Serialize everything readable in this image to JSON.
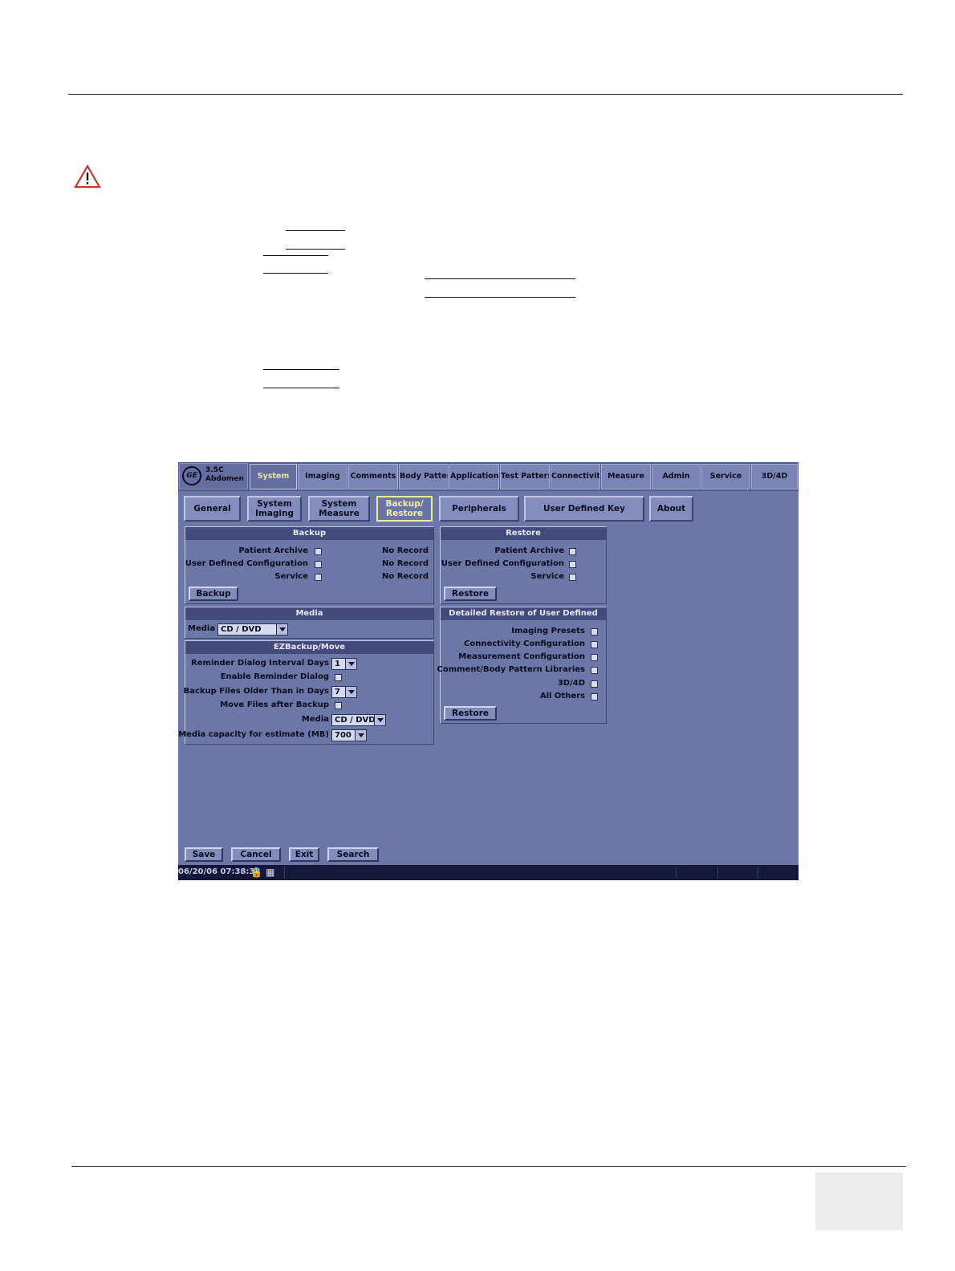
{
  "app": {
    "probe": "3.5C",
    "preset": "Abdomen",
    "logo_text": "GE"
  },
  "top_tabs": [
    {
      "label": "System"
    },
    {
      "label": "Imaging"
    },
    {
      "label": "Comments"
    },
    {
      "label": "Body Pattern"
    },
    {
      "label": "Application"
    },
    {
      "label": "Test Patterns"
    },
    {
      "label": "Connectivity"
    },
    {
      "label": "Measure"
    },
    {
      "label": "Admin"
    },
    {
      "label": "Service"
    },
    {
      "label": "3D/4D"
    }
  ],
  "sub_tabs": [
    {
      "label": "General"
    },
    {
      "label": "System\nImaging"
    },
    {
      "label": "System\nMeasure"
    },
    {
      "label": "Backup/\nRestore"
    },
    {
      "label": "Peripherals"
    },
    {
      "label": "User Defined Key"
    },
    {
      "label": "About"
    }
  ],
  "backup": {
    "title": "Backup",
    "rows": [
      {
        "label": "Patient Archive",
        "status": "No Record"
      },
      {
        "label": "User Defined Configuration",
        "status": "No Record"
      },
      {
        "label": "Service",
        "status": "No Record"
      }
    ],
    "button": "Backup"
  },
  "restore": {
    "title": "Restore",
    "rows": [
      {
        "label": "Patient Archive"
      },
      {
        "label": "User Defined Configuration"
      },
      {
        "label": "Service"
      }
    ],
    "button": "Restore"
  },
  "media": {
    "title": "Media",
    "label": "Media",
    "value": "CD / DVD"
  },
  "detailed_restore": {
    "title": "Detailed Restore of User Defined",
    "rows": [
      {
        "label": "Imaging Presets"
      },
      {
        "label": "Connectivity Configuration"
      },
      {
        "label": "Measurement Configuration"
      },
      {
        "label": "Comment/Body Pattern Libraries"
      },
      {
        "label": "3D/4D"
      },
      {
        "label": "All Others"
      }
    ],
    "button": "Restore"
  },
  "ezbackup": {
    "title": "EZBackup/Move",
    "reminder_label": "Reminder Dialog Interval Days",
    "reminder_value": "1",
    "enable_label": "Enable Reminder Dialog",
    "older_label": "Backup Files Older Than in Days",
    "older_value": "7",
    "move_label": "Move Files after Backup",
    "media_label": "Media",
    "media_value": "CD / DVD",
    "capacity_label": "Media capacity for estimate (MB)",
    "capacity_value": "700"
  },
  "bottom_buttons": {
    "save": "Save",
    "cancel": "Cancel",
    "exit": "Exit",
    "search": "Search"
  },
  "status": {
    "datetime": "06/20/06 07:38:38"
  }
}
